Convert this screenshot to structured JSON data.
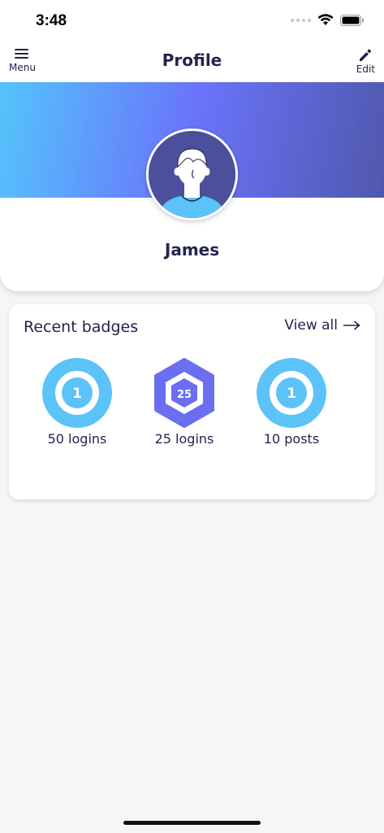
{
  "status_bar": {
    "time": "3:48"
  },
  "nav": {
    "title": "Profile",
    "menu_label": "Menu",
    "edit_label": "Edit"
  },
  "profile": {
    "name": "James"
  },
  "badges": {
    "title": "Recent badges",
    "view_all": "View all",
    "items": [
      {
        "label": "50 logins",
        "number": "1",
        "shape": "circle",
        "color": "#5bc3f8"
      },
      {
        "label": "25 logins",
        "number": "25",
        "shape": "hexagon",
        "color": "#6b6ef0"
      },
      {
        "label": "10 posts",
        "number": "1",
        "shape": "circle",
        "color": "#5bc3f8"
      }
    ]
  },
  "colors": {
    "primary_text": "#22244d",
    "banner_start": "#54c4fb",
    "banner_mid": "#6a73fb",
    "banner_end": "#5058ad",
    "badge_blue": "#5bc3f8",
    "badge_purple": "#6b6ef0"
  }
}
